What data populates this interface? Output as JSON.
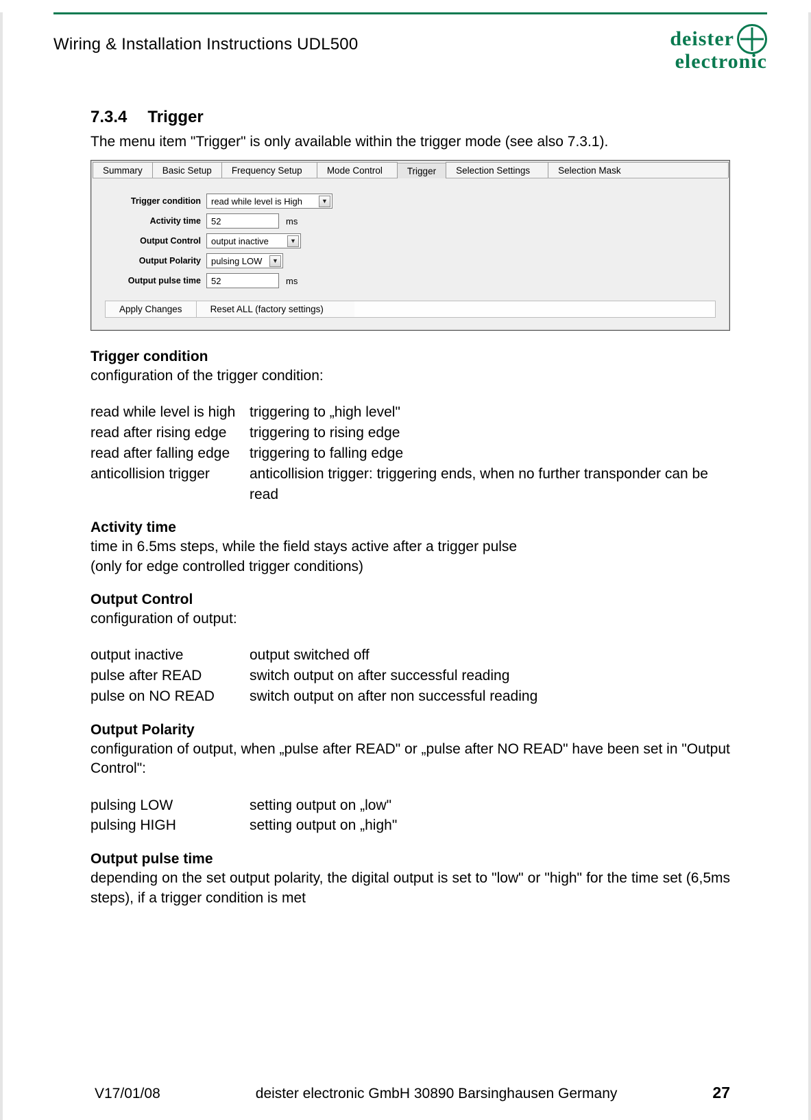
{
  "header": {
    "doc_title": "Wiring & Installation Instructions UDL500",
    "brand_line1": "deister",
    "brand_line2": "electronic"
  },
  "section": {
    "number": "7.3.4",
    "title": "Trigger",
    "intro": "The menu item \"Trigger\" is only available within the trigger mode (see also 7.3.1)."
  },
  "shot": {
    "tabs": [
      "Summary",
      "Basic Setup",
      "Frequency Setup",
      "Mode Control",
      "Trigger",
      "Selection Settings",
      "Selection Mask"
    ],
    "active_tab_index": 4,
    "rows": {
      "trigger_condition": {
        "label": "Trigger condition",
        "value": "read while level is High"
      },
      "activity_time": {
        "label": "Activity time",
        "value": "52",
        "unit": "ms"
      },
      "output_control": {
        "label": "Output Control",
        "value": "output inactive"
      },
      "output_polarity": {
        "label": "Output Polarity",
        "value": "pulsing LOW"
      },
      "output_pulse_time": {
        "label": "Output pulse time",
        "value": "52",
        "unit": "ms"
      }
    },
    "buttons": {
      "apply": "Apply Changes",
      "reset": "Reset ALL (factory settings)"
    }
  },
  "body": {
    "trigger_condition": {
      "heading": "Trigger condition",
      "desc": "configuration of the trigger condition:",
      "items": [
        {
          "k": "read while level is high",
          "v": "triggering to „high level\""
        },
        {
          "k": "read after rising edge",
          "v": "triggering to rising edge"
        },
        {
          "k": "read after falling edge",
          "v": "triggering to falling edge"
        },
        {
          "k": "anticollision trigger",
          "v": "anticollision trigger: triggering ends, when no further transponder can be read"
        }
      ]
    },
    "activity_time": {
      "heading": "Activity time",
      "line1": "time in 6.5ms steps, while the field stays active after a trigger pulse",
      "line2": "(only for edge controlled trigger conditions)"
    },
    "output_control": {
      "heading": "Output Control",
      "desc": "configuration of output:",
      "items": [
        {
          "k": "output inactive",
          "v": "output switched off"
        },
        {
          "k": "pulse after READ",
          "v": "switch output on after successful reading"
        },
        {
          "k": "pulse on NO READ",
          "v": "switch output on after non successful reading"
        }
      ]
    },
    "output_polarity": {
      "heading": "Output Polarity",
      "desc": "configuration of output, when „pulse after READ\" or „pulse after NO READ\" have been set in \"Output Control\":",
      "items": [
        {
          "k": "pulsing LOW",
          "v": "setting output on „low\""
        },
        {
          "k": "pulsing HIGH",
          "v": "setting output on „high\""
        }
      ]
    },
    "output_pulse_time": {
      "heading": "Output pulse time",
      "desc": "depending on the set output polarity, the digital output is set to \"low\" or \"high\" for the time set (6,5ms steps), if a trigger condition is met"
    }
  },
  "footer": {
    "version": "V17/01/08",
    "company": "deister electronic GmbH  30890 Barsinghausen  Germany",
    "page": "27"
  }
}
